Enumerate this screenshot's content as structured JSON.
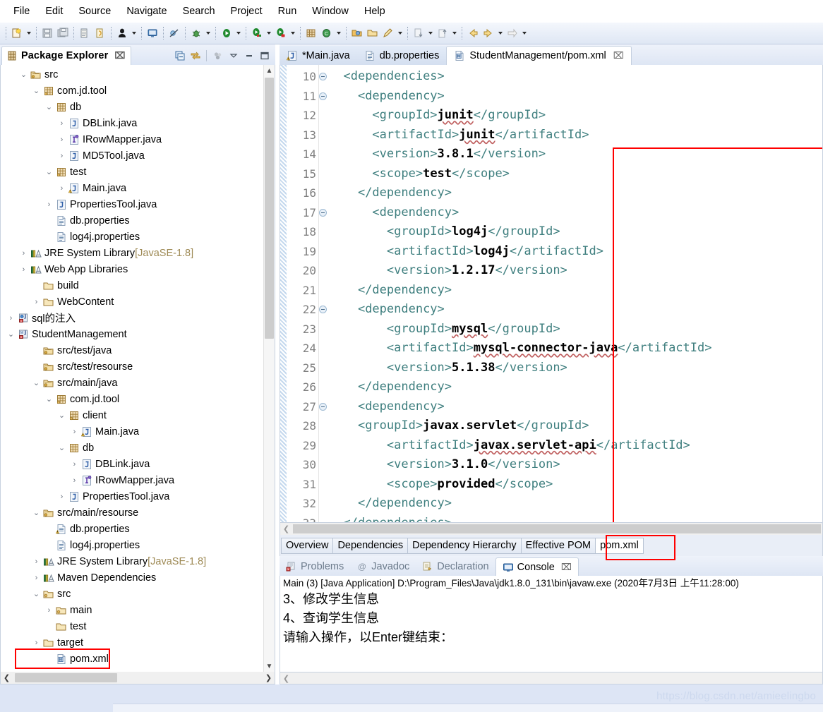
{
  "menubar": {
    "items": [
      {
        "label": "File"
      },
      {
        "label": "Edit"
      },
      {
        "label": "Source"
      },
      {
        "label": "Navigate"
      },
      {
        "label": "Search"
      },
      {
        "label": "Project"
      },
      {
        "label": "Run"
      },
      {
        "label": "Window"
      },
      {
        "label": "Help"
      }
    ]
  },
  "toolbar": {
    "icons": [
      "new-wizard-icon",
      "save-icon",
      "save-all-icon",
      "export-icon",
      "import-icon",
      "person-icon",
      "console-view-icon",
      "skip-breakpoints-icon",
      "debug-icon",
      "run-icon",
      "run-as-server-icon",
      "stop-server-icon",
      "new-java-project-icon",
      "new-class-icon",
      "open-type-icon",
      "open-folder-icon",
      "annotate-icon",
      "next-annotation-icon",
      "previous-annotation-icon",
      "back-icon",
      "forward-icon",
      "forward-nav-icon"
    ]
  },
  "package_explorer": {
    "title": "Package Explorer",
    "close_label": "⌧",
    "view_icons": [
      "collapse-all-icon",
      "link-with-editor-icon",
      "view-menu-dots-icon",
      "view-menu-icon",
      "minimize-icon",
      "maximize-icon"
    ],
    "tree": [
      {
        "indent": 1,
        "twisty": "⌄",
        "icon": "source-folder-icon",
        "label": "src"
      },
      {
        "indent": 2,
        "twisty": "⌄",
        "icon": "package-icon",
        "label": "com.jd.tool"
      },
      {
        "indent": 3,
        "twisty": "⌄",
        "icon": "package-plain-icon",
        "label": "db"
      },
      {
        "indent": 4,
        "twisty": "›",
        "icon": "java-class-icon",
        "label": "DBLink.java"
      },
      {
        "indent": 4,
        "twisty": "›",
        "icon": "java-interface-icon",
        "label": "IRowMapper.java"
      },
      {
        "indent": 4,
        "twisty": "›",
        "icon": "java-class-icon",
        "label": "MD5Tool.java"
      },
      {
        "indent": 3,
        "twisty": "⌄",
        "icon": "package-icon",
        "label": "test"
      },
      {
        "indent": 4,
        "twisty": "›",
        "icon": "java-class-warn-icon",
        "label": "Main.java"
      },
      {
        "indent": 3,
        "twisty": "›",
        "icon": "java-class-icon",
        "label": "PropertiesTool.java"
      },
      {
        "indent": 3,
        "twisty": "",
        "icon": "properties-file-icon",
        "label": "db.properties"
      },
      {
        "indent": 3,
        "twisty": "",
        "icon": "properties-file-icon",
        "label": "log4j.properties"
      },
      {
        "indent": 1,
        "twisty": "›",
        "icon": "library-icon",
        "label": "JRE System Library",
        "dim": " [JavaSE-1.8]"
      },
      {
        "indent": 1,
        "twisty": "›",
        "icon": "library-icon",
        "label": "Web App Libraries"
      },
      {
        "indent": 2,
        "twisty": "",
        "icon": "folder-icon",
        "label": "build"
      },
      {
        "indent": 2,
        "twisty": "›",
        "icon": "folder-icon",
        "label": "WebContent"
      },
      {
        "indent": 0,
        "twisty": "›",
        "icon": "java-project-icon",
        "label": "sql的注入"
      },
      {
        "indent": 0,
        "twisty": "⌄",
        "icon": "maven-project-icon",
        "label": "StudentManagement"
      },
      {
        "indent": 2,
        "twisty": "",
        "icon": "source-folder-icon",
        "label": "src/test/java"
      },
      {
        "indent": 2,
        "twisty": "",
        "icon": "source-folder-icon",
        "label": "src/test/resourse"
      },
      {
        "indent": 2,
        "twisty": "⌄",
        "icon": "source-folder-icon",
        "label": "src/main/java"
      },
      {
        "indent": 3,
        "twisty": "⌄",
        "icon": "package-icon",
        "label": "com.jd.tool"
      },
      {
        "indent": 4,
        "twisty": "⌄",
        "icon": "package-icon",
        "label": "client"
      },
      {
        "indent": 5,
        "twisty": "›",
        "icon": "java-class-warn-icon",
        "label": "Main.java"
      },
      {
        "indent": 4,
        "twisty": "⌄",
        "icon": "package-plain-icon",
        "label": "db"
      },
      {
        "indent": 5,
        "twisty": "›",
        "icon": "java-class-icon",
        "label": "DBLink.java"
      },
      {
        "indent": 5,
        "twisty": "›",
        "icon": "java-interface-icon",
        "label": "IRowMapper.java"
      },
      {
        "indent": 4,
        "twisty": "›",
        "icon": "java-class-icon",
        "label": "PropertiesTool.java"
      },
      {
        "indent": 2,
        "twisty": "⌄",
        "icon": "source-folder-icon",
        "label": "src/main/resourse"
      },
      {
        "indent": 3,
        "twisty": "",
        "icon": "properties-warn-icon",
        "label": "db.properties"
      },
      {
        "indent": 3,
        "twisty": "",
        "icon": "properties-file-icon",
        "label": "log4j.properties"
      },
      {
        "indent": 2,
        "twisty": "›",
        "icon": "library-icon",
        "label": "JRE System Library",
        "dim": " [JavaSE-1.8]"
      },
      {
        "indent": 2,
        "twisty": "›",
        "icon": "library-icon",
        "label": "Maven Dependencies"
      },
      {
        "indent": 2,
        "twisty": "⌄",
        "icon": "folder-src-icon",
        "label": "src"
      },
      {
        "indent": 3,
        "twisty": "›",
        "icon": "folder-src-icon",
        "label": "main"
      },
      {
        "indent": 3,
        "twisty": "",
        "icon": "folder-icon",
        "label": "test"
      },
      {
        "indent": 2,
        "twisty": "›",
        "icon": "folder-icon",
        "label": "target"
      },
      {
        "indent": 3,
        "twisty": "",
        "icon": "maven-pom-icon",
        "label": "pom.xml",
        "highlight": true
      }
    ]
  },
  "editor": {
    "tabs": [
      {
        "label": "*Main.java",
        "icon": "java-class-warn-icon",
        "active": false,
        "closable": false
      },
      {
        "label": "db.properties",
        "icon": "properties-file-icon",
        "active": false,
        "closable": false
      },
      {
        "label": "StudentManagement/pom.xml",
        "icon": "maven-pom-icon",
        "active": true,
        "closable": true,
        "close_label": "⌧"
      }
    ],
    "first_line_number": 10,
    "lines": [
      {
        "n": 10,
        "fold": true,
        "indent": 1,
        "parts": [
          {
            "t": "tag",
            "s": "<dependencies>"
          }
        ]
      },
      {
        "n": 11,
        "fold": true,
        "indent": 2,
        "parts": [
          {
            "t": "tag",
            "s": "<dependency>"
          }
        ]
      },
      {
        "n": 12,
        "fold": false,
        "indent": 3,
        "parts": [
          {
            "t": "tag",
            "s": "<groupId>"
          },
          {
            "t": "val",
            "s": "junit",
            "sq": true
          },
          {
            "t": "tag",
            "s": "</groupId>"
          }
        ]
      },
      {
        "n": 13,
        "fold": false,
        "indent": 3,
        "parts": [
          {
            "t": "tag",
            "s": "<artifactId>"
          },
          {
            "t": "val",
            "s": "junit",
            "sq": true
          },
          {
            "t": "tag",
            "s": "</artifactId>"
          }
        ]
      },
      {
        "n": 14,
        "fold": false,
        "indent": 3,
        "parts": [
          {
            "t": "tag",
            "s": "<version>"
          },
          {
            "t": "val",
            "s": "3.8.1"
          },
          {
            "t": "tag",
            "s": "</version>"
          }
        ]
      },
      {
        "n": 15,
        "fold": false,
        "indent": 3,
        "parts": [
          {
            "t": "tag",
            "s": "<scope>"
          },
          {
            "t": "val",
            "s": "test"
          },
          {
            "t": "tag",
            "s": "</scope>"
          }
        ]
      },
      {
        "n": 16,
        "fold": false,
        "indent": 2,
        "parts": [
          {
            "t": "tag",
            "s": "</dependency>"
          }
        ]
      },
      {
        "n": 17,
        "fold": true,
        "indent": 3,
        "parts": [
          {
            "t": "tag",
            "s": "<dependency>"
          }
        ]
      },
      {
        "n": 18,
        "fold": false,
        "indent": 4,
        "parts": [
          {
            "t": "tag",
            "s": "<groupId>"
          },
          {
            "t": "val",
            "s": "log4j"
          },
          {
            "t": "tag",
            "s": "</groupId>"
          }
        ]
      },
      {
        "n": 19,
        "fold": false,
        "indent": 4,
        "parts": [
          {
            "t": "tag",
            "s": "<artifactId>"
          },
          {
            "t": "val",
            "s": "log4j"
          },
          {
            "t": "tag",
            "s": "</artifactId>"
          }
        ]
      },
      {
        "n": 20,
        "fold": false,
        "indent": 4,
        "parts": [
          {
            "t": "tag",
            "s": "<version>"
          },
          {
            "t": "val",
            "s": "1.2.17"
          },
          {
            "t": "tag",
            "s": "</version>"
          }
        ]
      },
      {
        "n": 21,
        "fold": false,
        "indent": 2,
        "parts": [
          {
            "t": "tag",
            "s": "</dependency>"
          }
        ]
      },
      {
        "n": 22,
        "fold": true,
        "indent": 2,
        "parts": [
          {
            "t": "tag",
            "s": "<dependency>"
          }
        ]
      },
      {
        "n": 23,
        "fold": false,
        "indent": 4,
        "parts": [
          {
            "t": "tag",
            "s": "<groupId>"
          },
          {
            "t": "val",
            "s": "mysql",
            "sq": true
          },
          {
            "t": "tag",
            "s": "</groupId>"
          }
        ]
      },
      {
        "n": 24,
        "fold": false,
        "indent": 4,
        "parts": [
          {
            "t": "tag",
            "s": "<artifactId>"
          },
          {
            "t": "val",
            "s": "mysql-connector-java",
            "sq": true
          },
          {
            "t": "tag",
            "s": "</artifactId>"
          }
        ]
      },
      {
        "n": 25,
        "fold": false,
        "indent": 4,
        "parts": [
          {
            "t": "tag",
            "s": "<version>"
          },
          {
            "t": "val",
            "s": "5.1.38"
          },
          {
            "t": "tag",
            "s": "</version>"
          }
        ]
      },
      {
        "n": 26,
        "fold": false,
        "indent": 2,
        "parts": [
          {
            "t": "tag",
            "s": "</dependency>"
          }
        ]
      },
      {
        "n": 27,
        "fold": true,
        "indent": 2,
        "parts": [
          {
            "t": "tag",
            "s": "<dependency>"
          }
        ]
      },
      {
        "n": 28,
        "fold": false,
        "indent": 2,
        "parts": [
          {
            "t": "tag",
            "s": "<groupId>"
          },
          {
            "t": "val",
            "s": "javax.servlet"
          },
          {
            "t": "tag",
            "s": "</groupId>"
          }
        ]
      },
      {
        "n": 29,
        "fold": false,
        "indent": 4,
        "parts": [
          {
            "t": "tag",
            "s": "<artifactId>"
          },
          {
            "t": "val",
            "s": "javax.servlet-api",
            "sq": true
          },
          {
            "t": "tag",
            "s": "</artifactId>"
          }
        ]
      },
      {
        "n": 30,
        "fold": false,
        "indent": 4,
        "parts": [
          {
            "t": "tag",
            "s": "<version>"
          },
          {
            "t": "val",
            "s": "3.1.0"
          },
          {
            "t": "tag",
            "s": "</version>"
          }
        ]
      },
      {
        "n": 31,
        "fold": false,
        "indent": 4,
        "parts": [
          {
            "t": "tag",
            "s": "<scope>"
          },
          {
            "t": "val",
            "s": "provided"
          },
          {
            "t": "tag",
            "s": "</scope>"
          }
        ]
      },
      {
        "n": 32,
        "fold": false,
        "indent": 2,
        "parts": [
          {
            "t": "tag",
            "s": "</dependency>"
          }
        ]
      },
      {
        "n": 33,
        "fold": false,
        "indent": 1,
        "parts": [
          {
            "t": "tag",
            "s": "</dependencies>"
          }
        ]
      }
    ]
  },
  "pom_form_tabs": {
    "items": [
      {
        "label": "Overview",
        "active": false
      },
      {
        "label": "Dependencies",
        "active": false
      },
      {
        "label": "Dependency Hierarchy",
        "active": false
      },
      {
        "label": "Effective POM",
        "active": false
      },
      {
        "label": "pom.xml",
        "active": true,
        "highlight": true
      }
    ]
  },
  "console": {
    "tabs": [
      {
        "label": "Problems",
        "icon": "problems-icon",
        "active": false
      },
      {
        "label": "Javadoc",
        "icon": "javadoc-icon",
        "active": false
      },
      {
        "label": "Declaration",
        "icon": "declaration-icon",
        "active": false
      },
      {
        "label": "Console",
        "icon": "console-icon",
        "active": true,
        "close_label": "⌧"
      }
    ],
    "header": "Main (3) [Java Application] D:\\Program_Files\\Java\\jdk1.8.0_131\\bin\\javaw.exe (2020年7月3日 上午11:28:00)",
    "lines": [
      "3、修改学生信息",
      "4、查询学生信息",
      "请输入操作，以Enter键结束："
    ]
  },
  "statusbar": {
    "watermark": "https://blog.csdn.net/amieelingbo"
  },
  "colors": {
    "highlight_red": "#ff0000",
    "xml_tag": "#3f7f7f",
    "xml_value": "#000000",
    "dim_text": "#9e8a55",
    "line_number": "#808080"
  }
}
